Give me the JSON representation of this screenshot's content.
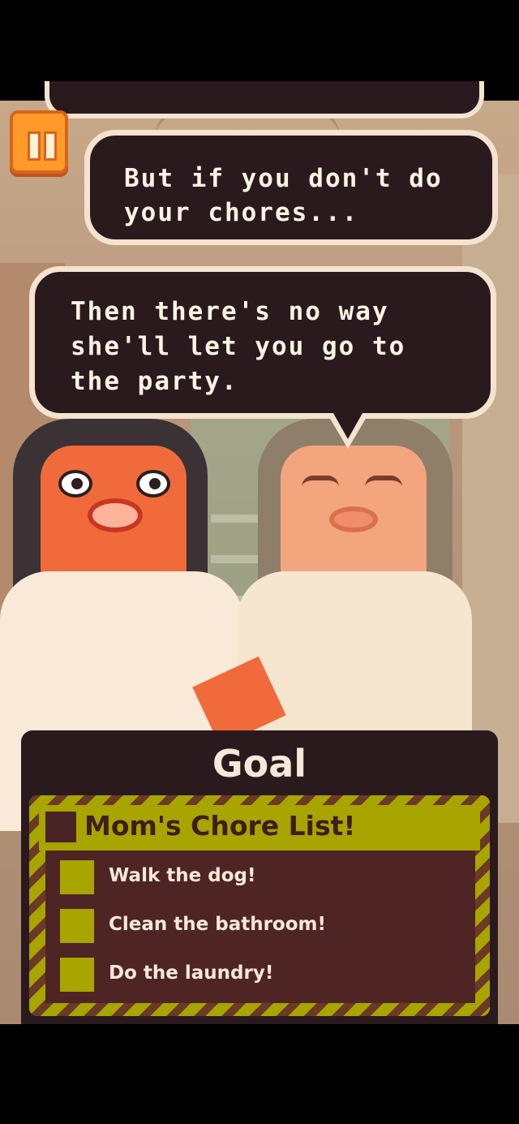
{
  "dialogue": {
    "bubble_1": "But if you don't do your chores...",
    "bubble_2": "Then there's no way she'll let you go to the party."
  },
  "pause_button": {
    "icon": "pause-icon"
  },
  "goal": {
    "title": "Goal",
    "list_title": "Mom's Chore List!",
    "items": [
      {
        "label": "Walk the dog!",
        "checked": false
      },
      {
        "label": "Clean the bathroom!",
        "checked": false
      },
      {
        "label": "Do the laundry!",
        "checked": false
      }
    ]
  },
  "colors": {
    "bubble_bg": "#2a1a1e",
    "bubble_border": "#f3e3cf",
    "pause_orange": "#ff9a2a",
    "checklist_yellow": "#a8a400"
  }
}
